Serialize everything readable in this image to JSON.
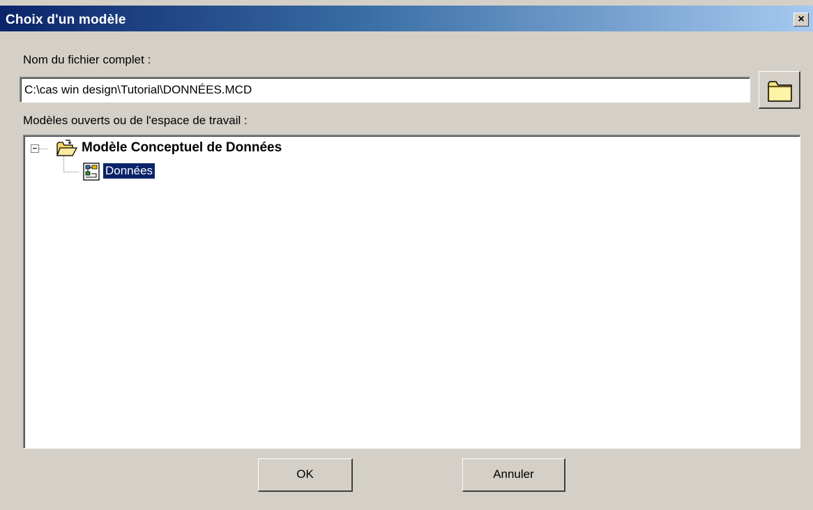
{
  "window": {
    "title": "Choix d'un modèle",
    "close_glyph": "✕"
  },
  "file": {
    "label": "Nom du fichier complet :",
    "value": "C:\\cas win design\\Tutorial\\DONNÉES.MCD"
  },
  "models": {
    "label": "Modèles ouverts ou de l'espace de travail :",
    "root": {
      "label": "Modèle Conceptuel de Données",
      "icon": "open-folder-icon",
      "expanded": true
    },
    "children": [
      {
        "label": "Données",
        "icon": "model-diagram-icon",
        "selected": true
      }
    ]
  },
  "buttons": {
    "ok": "OK",
    "cancel": "Annuler",
    "browse_icon": "folder-icon"
  },
  "colors": {
    "title_start": "#0a246a",
    "title_end": "#a6caf0",
    "dialog_bg": "#d4d0c8",
    "selection_bg": "#0a246a"
  }
}
